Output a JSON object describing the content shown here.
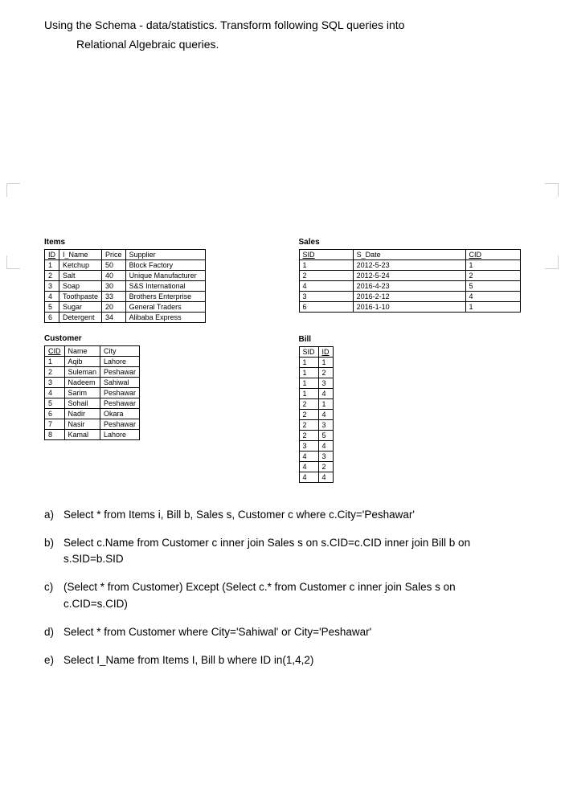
{
  "intro": {
    "line1": "Using the Schema - data/statistics. Transform following SQL queries into",
    "line2": "Relational Algebraic queries."
  },
  "tables": {
    "items": {
      "title": "Items",
      "headers": [
        "ID",
        "I_Name",
        "Price",
        "Supplier"
      ],
      "pk": [
        0
      ],
      "rows": [
        [
          "1",
          "Ketchup",
          "50",
          "Block Factory"
        ],
        [
          "2",
          "Salt",
          "40",
          "Unique Manufacturer"
        ],
        [
          "3",
          "Soap",
          "30",
          "S&S International"
        ],
        [
          "4",
          "Toothpaste",
          "33",
          "Brothers Enterprise"
        ],
        [
          "5",
          "Sugar",
          "20",
          "General Traders"
        ],
        [
          "6",
          "Detergent",
          "34",
          "Alibaba Express"
        ]
      ]
    },
    "customer": {
      "title": "Customer",
      "headers": [
        "CID",
        "Name",
        "City"
      ],
      "pk": [
        0
      ],
      "rows": [
        [
          "1",
          "Aqib",
          "Lahore"
        ],
        [
          "2",
          "Suleman",
          "Peshawar"
        ],
        [
          "3",
          "Nadeem",
          "Sahiwal"
        ],
        [
          "4",
          "Sarim",
          "Peshawar"
        ],
        [
          "5",
          "Sohail",
          "Peshawar"
        ],
        [
          "6",
          "Nadir",
          "Okara"
        ],
        [
          "7",
          "Nasir",
          "Peshawar"
        ],
        [
          "8",
          "Kamal",
          "Lahore"
        ]
      ]
    },
    "sales": {
      "title": "Sales",
      "headers": [
        "SID",
        "S_Date",
        "CID"
      ],
      "pk": [
        0,
        2
      ],
      "rows": [
        [
          "1",
          "2012-5-23",
          "1"
        ],
        [
          "2",
          "2012-5-24",
          "2"
        ],
        [
          "4",
          "2016-4-23",
          "5"
        ],
        [
          "3",
          "2016-2-12",
          "4"
        ],
        [
          "6",
          "2016-1-10",
          "1"
        ]
      ]
    },
    "bill": {
      "title": "Bill",
      "headers": [
        "SID",
        "ID"
      ],
      "pk": [
        1
      ],
      "rows": [
        [
          "1",
          "1"
        ],
        [
          "1",
          "2"
        ],
        [
          "1",
          "3"
        ],
        [
          "1",
          "4"
        ],
        [
          "2",
          "1"
        ],
        [
          "2",
          "4"
        ],
        [
          "2",
          "3"
        ],
        [
          "2",
          "5"
        ],
        [
          "3",
          "4"
        ],
        [
          "4",
          "3"
        ],
        [
          "4",
          "2"
        ],
        [
          "4",
          "4"
        ]
      ]
    }
  },
  "questions": [
    {
      "label": "a)",
      "text": "Select * from Items i, Bill b, Sales s, Customer c where c.City='Peshawar'"
    },
    {
      "label": "b)",
      "text": "Select c.Name from Customer c inner join Sales s on s.CID=c.CID inner join Bill b on s.SID=b.SID"
    },
    {
      "label": "c)",
      "text": "(Select * from Customer) Except (Select c.* from Customer c inner join Sales s on c.CID=s.CID)"
    },
    {
      "label": "d)",
      "text": "Select * from Customer where City='Sahiwal' or City='Peshawar'"
    },
    {
      "label": "e)",
      "text": "Select I_Name from Items I, Bill b  where ID in(1,4,2)"
    }
  ]
}
